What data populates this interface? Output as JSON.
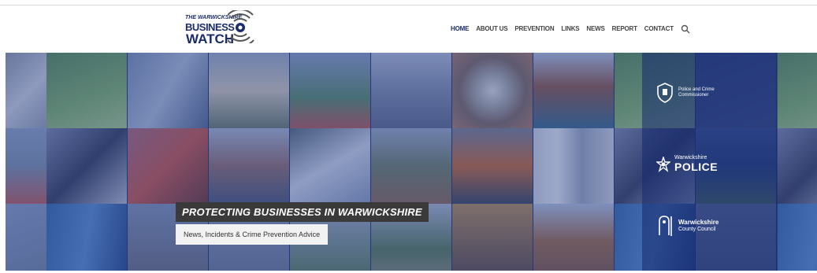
{
  "logo": {
    "line1": "THE WARWICKSHIRE",
    "line2": "BUSINESS",
    "line3": "WATCH"
  },
  "nav": {
    "items": [
      "HOME",
      "ABOUT US",
      "PREVENTION",
      "LINKS",
      "NEWS",
      "REPORT",
      "CONTACT"
    ],
    "search_icon": "search-icon",
    "active_color": "#1b2c6a"
  },
  "hero": {
    "headline": "PROTECTING BUSINESSES IN WARWICKSHIRE",
    "subline": "News, Incidents & Crime Prevention Advice",
    "partners": {
      "pcc": "Police and Crime Commissioner",
      "police_line1": "Warwickshire",
      "police_line2": "POLICE",
      "council_line1": "Warwickshire",
      "council_line2": "County Council"
    },
    "overlay_color": "#233c8c"
  }
}
